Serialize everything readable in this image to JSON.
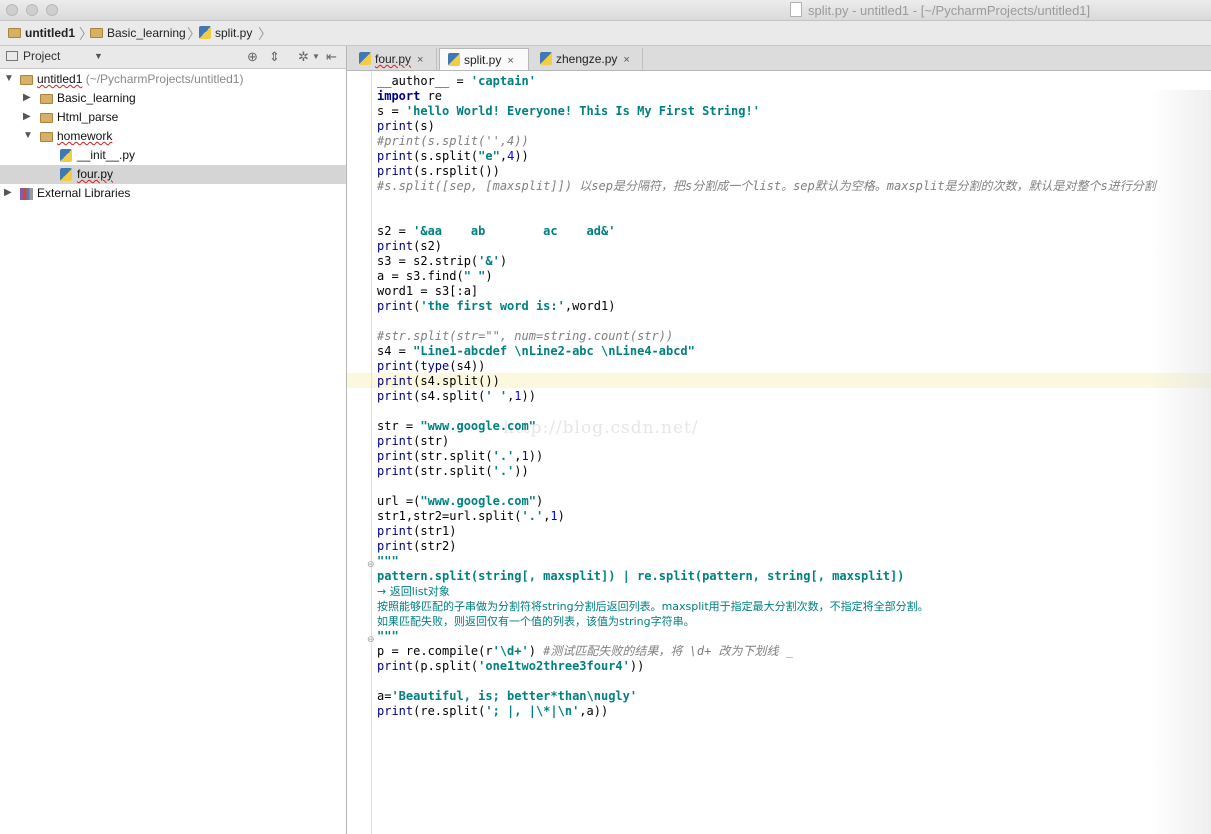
{
  "window": {
    "title": "split.py - untitled1 - [~/PycharmProjects/untitled1]"
  },
  "breadcrumb": {
    "items": [
      "untitled1",
      "Basic_learning",
      "split.py"
    ]
  },
  "project_panel": {
    "selector_label": "Project",
    "tree": [
      {
        "label": "untitled1",
        "suffix": "(~/PycharmProjects/untitled1)",
        "icon": "folder-icon"
      },
      {
        "label": "Basic_learning",
        "icon": "folder-icon"
      },
      {
        "label": "Html_parse",
        "icon": "folder-icon"
      },
      {
        "label": "homework",
        "icon": "folder-icon"
      },
      {
        "label": "__init__.py",
        "icon": "python-file-icon"
      },
      {
        "label": "four.py",
        "icon": "python-file-icon"
      },
      {
        "label": "External Libraries",
        "icon": "library-icon"
      }
    ]
  },
  "tabs": [
    {
      "label": "four.py",
      "close": "×"
    },
    {
      "label": "split.py",
      "close": "×"
    },
    {
      "label": "zhengze.py",
      "close": "×"
    }
  ],
  "code": {
    "lines": [
      "__author__ = 'captain'",
      "import re",
      "s = 'hello World! Everyone! This Is My First String!'",
      "print(s)",
      "#print(s.split('',4))",
      "print(s.split(\"e\",4))",
      "print(s.rsplit())",
      "#s.split([sep, [maxsplit]]) 以sep是分隔符，把s分割成一个list。sep默认为空格。maxsplit是分割的次数，默认是对整个s进行分割",
      "",
      "",
      "s2 = '&aa    ab        ac    ad&'",
      "print(s2)",
      "s3 = s2.strip('&')",
      "a = s3.find(\" \")",
      "word1 = s3[:a]",
      "print('the first word is:',word1)",
      "",
      "#str.split(str=\"\", num=string.count(str))",
      "s4 = \"Line1-abcdef \\nLine2-abc \\nLine4-abcd\"",
      "print(type(s4))",
      "print(s4.split())",
      "print(s4.split(' ',1))",
      "",
      "str = \"www.google.com\"",
      "print(str)",
      "print(str.split('.',1))",
      "print(str.split('.'))",
      "",
      "url =(\"www.google.com\")",
      "str1,str2=url.split('.',1)",
      "print(str1)",
      "print(str2)",
      "\"\"\"",
      "pattern.split(string[, maxsplit]) | re.split(pattern, string[, maxsplit])",
      "→ 返回list对象",
      "按照能够匹配的子串做为分割符将string分割后返回列表。maxsplit用于指定最大分割次数，不指定将全部分割。",
      "如果匹配失败，则返回仅有一个值的列表，该值为string字符串。",
      "\"\"\"",
      "p = re.compile(r'\\d+') #测试匹配失败的结果，将 \\d+ 改为下划线 _",
      "print(p.split('one1two2three3four4'))",
      "",
      "a='Beautiful, is; better*than\\nugly'",
      "print(re.split('; |, |\\*|\\n',a))"
    ]
  },
  "watermark": "http://blog.csdn.net/"
}
